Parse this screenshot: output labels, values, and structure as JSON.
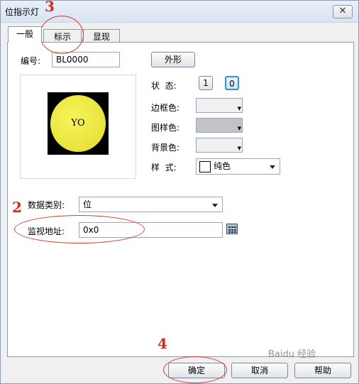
{
  "window": {
    "title": "位指示灯",
    "close_glyph": "✕"
  },
  "tabs": [
    {
      "label": "一般"
    },
    {
      "label": "标示"
    },
    {
      "label": "显现"
    }
  ],
  "general": {
    "id_label": "编号:",
    "id_value": "BL0000",
    "shape_button": "外形",
    "preview_text": "YO",
    "state_label": "状  态:",
    "state_options": [
      "1",
      "0"
    ],
    "state_selected": "0",
    "border_color_label": "边框色:",
    "pattern_color_label": "图样色:",
    "bg_color_label": "背景色:",
    "style_label": "样  式:",
    "style_value": "纯色",
    "data_type_label": "数据类别:",
    "data_type_value": "位",
    "monitor_label": "监视地址:",
    "monitor_value": "0x0"
  },
  "colors": {
    "border_color": "#f0f0f0",
    "pattern_color": "#c3c3c3",
    "bg_color": "#f0f0f0",
    "lamp_color": "#eeea3c"
  },
  "buttons": {
    "ok": "确定",
    "cancel": "取消",
    "help": "帮助"
  },
  "annotations": [
    "2",
    "3",
    "4"
  ],
  "watermark": "Baidu 经验"
}
